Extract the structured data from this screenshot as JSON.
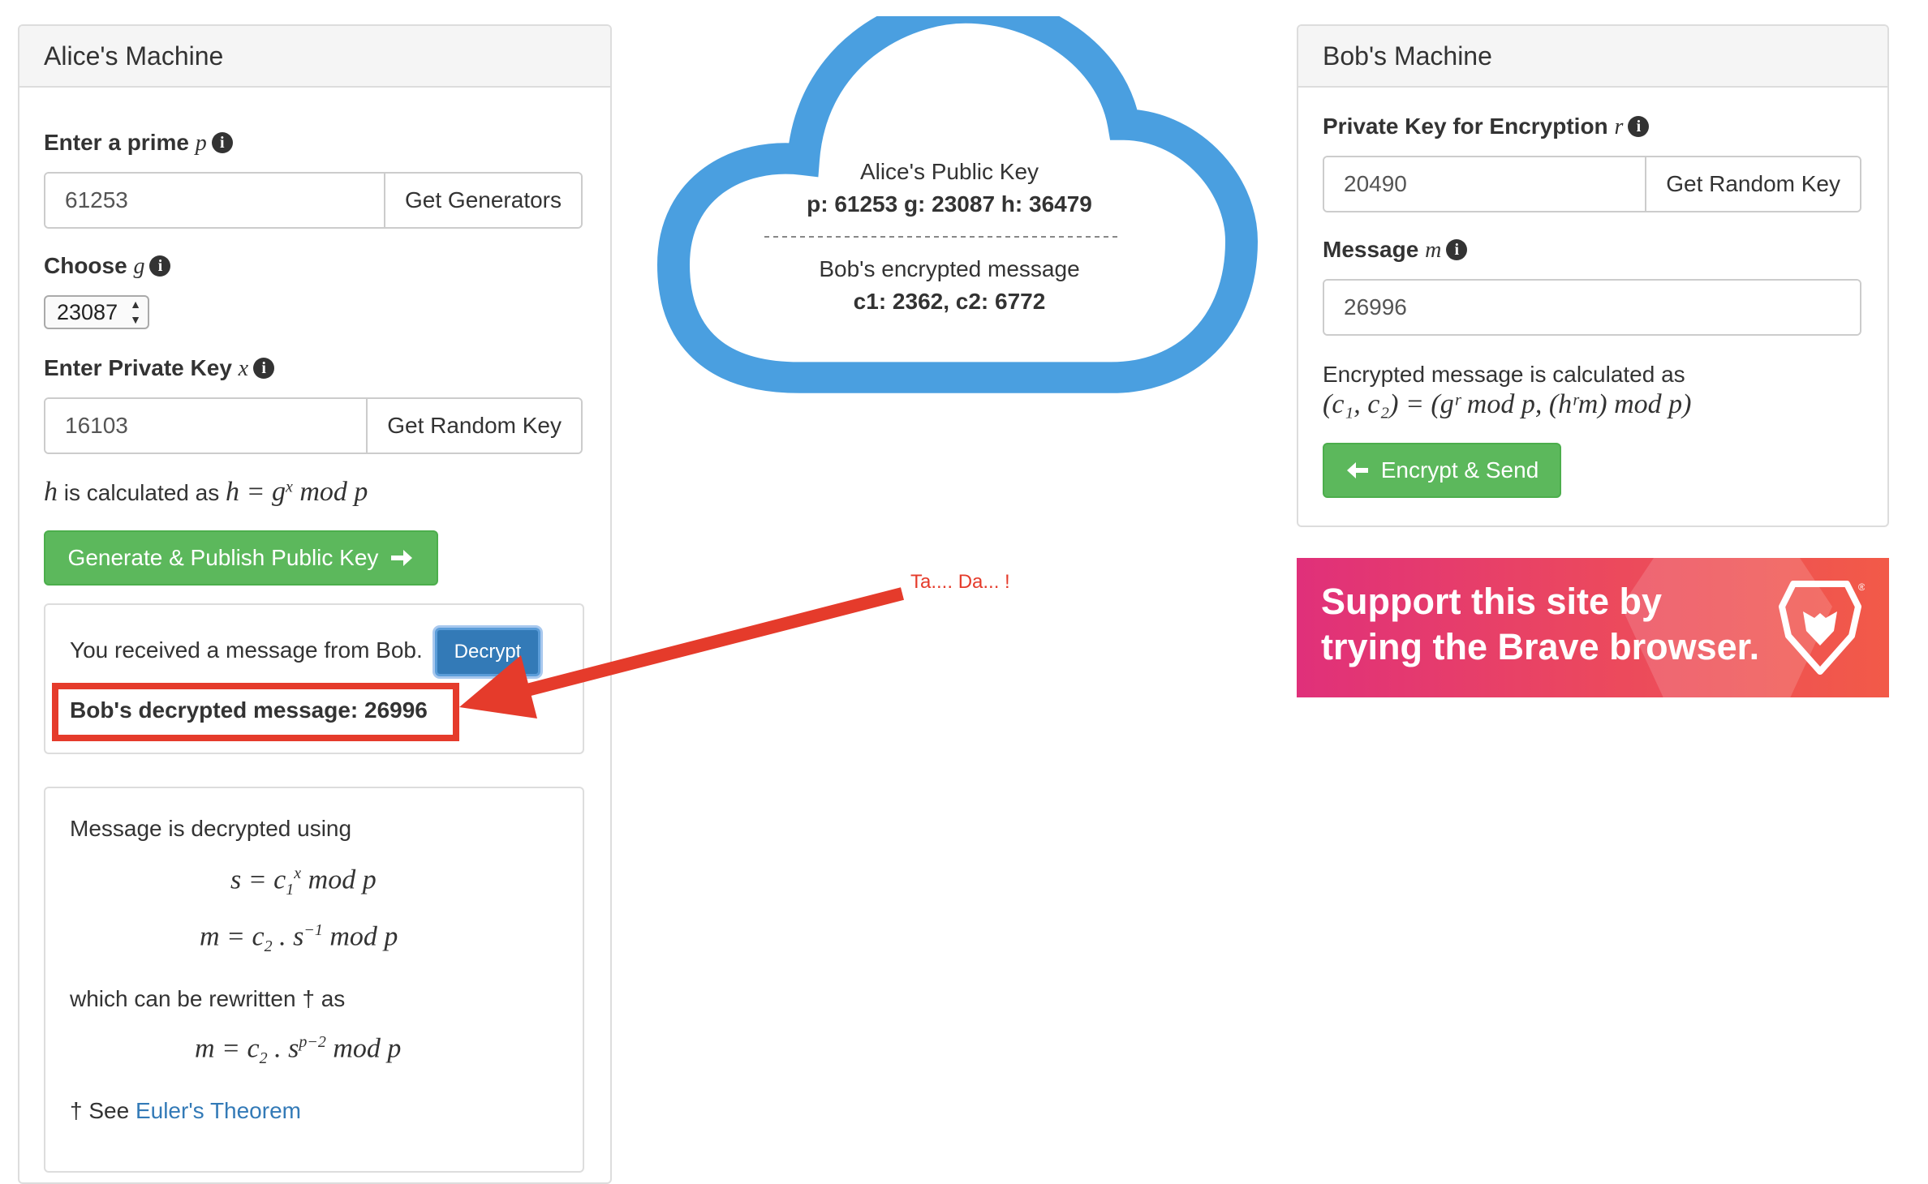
{
  "alice": {
    "title": "Alice's Machine",
    "prime_label": "Enter a prime ",
    "prime_var": "p",
    "prime_value": "61253",
    "get_generators_label": "Get Generators",
    "choose_label": "Choose ",
    "choose_var": "g",
    "g_selected": "23087",
    "private_key_label": "Enter Private Key ",
    "private_key_var": "x",
    "private_key_value": "16103",
    "get_random_key_label": "Get Random Key",
    "h_calc_prefix": "h",
    "h_calc_text": " is calculated as ",
    "h_formula": "h = g",
    "h_formula_exp": "x",
    "h_formula_tail": " mod p",
    "publish_label": "Generate & Publish Public Key",
    "received_text": "You received a message from Bob.",
    "decrypt_label": "Decrypt",
    "decrypted_text": "Bob's decrypted message: 26996",
    "decrypt_intro": "Message is decrypted using",
    "formula1": {
      "lhs": "s = c",
      "sub": "1",
      "sup": "x",
      "tail": " mod p"
    },
    "formula2": {
      "lhs": "m = c",
      "sub": "2",
      "mid": " . s",
      "sup": "−1",
      "tail": " mod p"
    },
    "rewritten_text": "which can be rewritten † as",
    "formula3": {
      "lhs": "m = c",
      "sub": "2",
      "mid": " . s",
      "sup": "p−2",
      "tail": " mod p"
    },
    "see_prefix": "† See ",
    "euler_link": "Euler's Theorem"
  },
  "cloud": {
    "public_key_title": "Alice's Public Key",
    "public_key_values": "p: 61253 g: 23087 h: 36479",
    "encrypted_title": "Bob's encrypted message",
    "encrypted_values": "c1: 2362, c2: 6772",
    "cloud_color": "#4a9fe0"
  },
  "bob": {
    "title": "Bob's Machine",
    "private_key_label": "Private Key for Encryption ",
    "private_key_var": "r",
    "private_key_value": "20490",
    "get_random_key_label": "Get Random Key",
    "message_label": "Message ",
    "message_var": "m",
    "message_value": "26996",
    "encrypted_calc_text": "Encrypted message is calculated as",
    "encrypted_formula": "(c₁, c₂) = (gʳ mod p, (hʳm) mod p)",
    "encrypt_send_label": "Encrypt & Send"
  },
  "annotation": {
    "text": "Ta.... Da... !",
    "color": "#e53b2b"
  },
  "ad": {
    "line1": "Support this site by",
    "line2": "trying the Brave browser."
  },
  "icons": {
    "info": "info-icon",
    "right_arrow": "arrow-right-icon",
    "left_arrow": "arrow-left-icon",
    "select_arrows": "select-arrows-icon",
    "brave_logo": "brave-lion-logo"
  }
}
